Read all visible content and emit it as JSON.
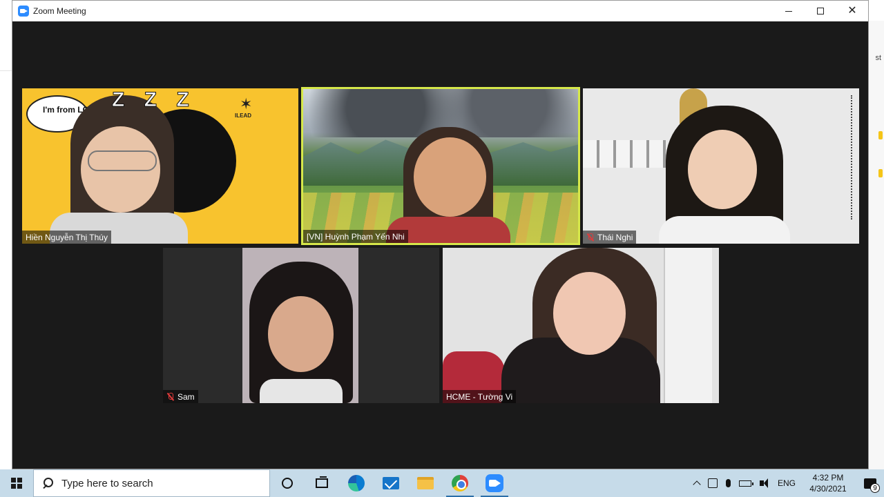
{
  "window": {
    "title": "Zoom Meeting",
    "controls": {
      "minimize": "minimize",
      "maximize": "maximize",
      "close": "close"
    }
  },
  "background_app": {
    "peek_text": "st"
  },
  "participants": [
    {
      "name": "Hiền Nguyễn Thị Thúy",
      "muted": false,
      "active_speaker": false
    },
    {
      "name": "[VN] Huỳnh Phạm Yến Nhi",
      "muted": false,
      "active_speaker": true
    },
    {
      "name": "Thái Nghi",
      "muted": true,
      "active_speaker": false
    },
    {
      "name": "Sam",
      "muted": true,
      "active_speaker": false
    },
    {
      "name": "HCME - Tường Vi",
      "muted": false,
      "active_speaker": false
    }
  ],
  "tile_1_decor": {
    "badge_text": "I'm from LC HCM",
    "logo_text": "ILEAD",
    "zzz": "Z Z Z"
  },
  "taskbar": {
    "search_placeholder": "Type here to search",
    "pinned_apps": [
      "cortana-icon",
      "task-view-icon",
      "edge-icon",
      "mail-icon",
      "file-explorer-icon",
      "chrome-icon",
      "zoom-icon"
    ],
    "language": "ENG",
    "time": "4:32 PM",
    "date": "4/30/2021",
    "notification_count": "9"
  },
  "colors": {
    "window_bg": "#1a1a1a",
    "active_speaker_border": "#d6e84a",
    "taskbar_bg": "#c6dbe9",
    "zoom_blue": "#2d8cff",
    "muted_red": "#e03b3b"
  }
}
